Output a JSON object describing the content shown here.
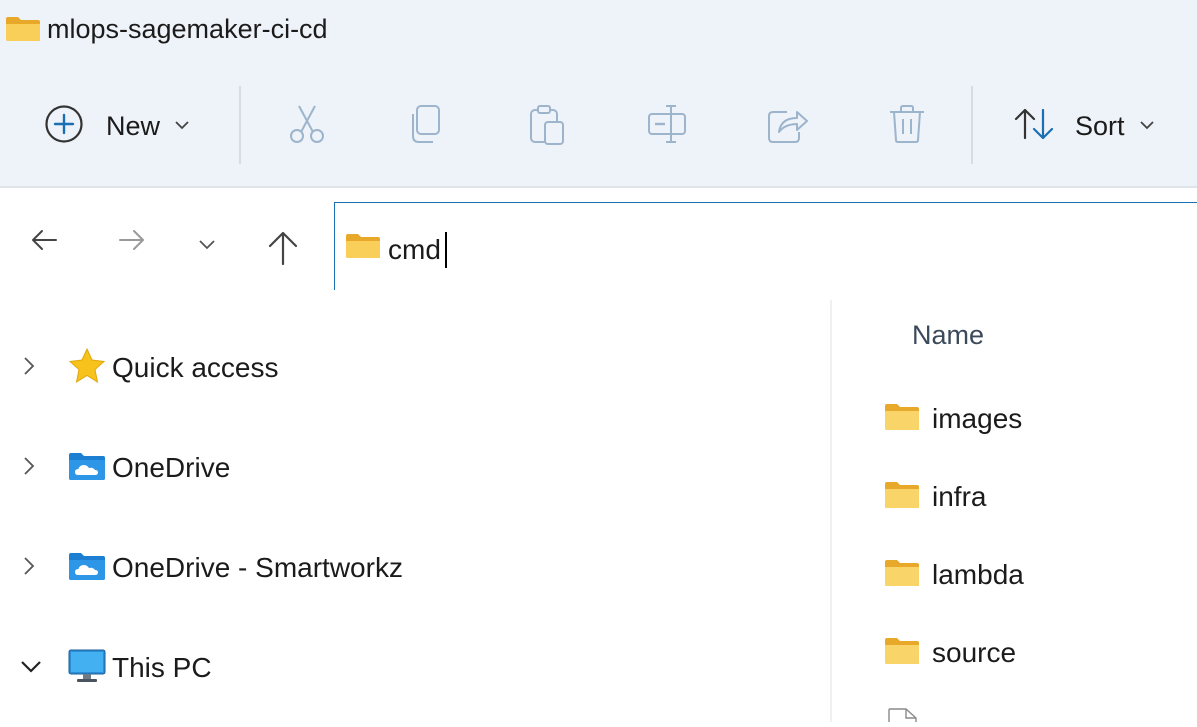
{
  "window": {
    "title": "mlops-sagemaker-ci-cd"
  },
  "toolbar": {
    "new_label": "New",
    "sort_label": "Sort",
    "icons": [
      "cut-icon",
      "copy-icon",
      "paste-icon",
      "rename-icon",
      "share-icon",
      "delete-icon"
    ]
  },
  "address_bar": {
    "value": "cmd"
  },
  "navigation_pane": {
    "items": [
      {
        "label": "Quick access",
        "icon": "star-icon",
        "expanded": false
      },
      {
        "label": "OneDrive",
        "icon": "onedrive-folder-icon",
        "expanded": false
      },
      {
        "label": "OneDrive - Smartworkz",
        "icon": "onedrive-folder-icon",
        "expanded": false
      },
      {
        "label": "This PC",
        "icon": "monitor-icon",
        "expanded": true
      }
    ]
  },
  "file_list": {
    "column_header": "Name",
    "items": [
      {
        "name": "images",
        "type": "folder"
      },
      {
        "name": "infra",
        "type": "folder"
      },
      {
        "name": "lambda",
        "type": "folder"
      },
      {
        "name": "source",
        "type": "folder"
      }
    ]
  },
  "colors": {
    "accent": "#1a6fb3",
    "toolbar_bg": "#eef2f9",
    "folder": "#f8c94a"
  }
}
